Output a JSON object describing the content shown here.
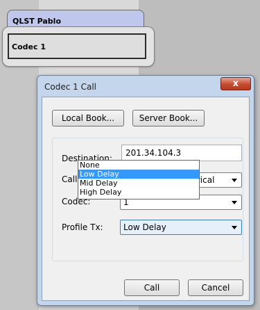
{
  "window": {
    "title": "QLST Pablo"
  },
  "codec_panel": {
    "label": "Codec 1"
  },
  "dialog": {
    "title": "Codec 1 Call",
    "close_glyph": "x",
    "local_book_label": "Local Book...",
    "server_book_label": "Server Book...",
    "destination_label": "Destination:",
    "destination_value": "201.34.104.3",
    "call_type_label": "Call Type:",
    "call_type_value": "Two Way Symmetrical",
    "codec_label": "Codec:",
    "codec_value": "1",
    "profile_label": "Profile Tx:",
    "profile_value": "Low Delay",
    "profile_options": [
      "None",
      "Low Delay",
      "Mid Delay",
      "High Delay"
    ],
    "profile_selected": "Low Delay",
    "call_label": "Call",
    "cancel_label": "Cancel"
  },
  "colors": {
    "tab": "#bfc8ec",
    "dialog_frame": "#c4d6ec",
    "close": "#c74b2f",
    "highlight": "#3399ff"
  }
}
